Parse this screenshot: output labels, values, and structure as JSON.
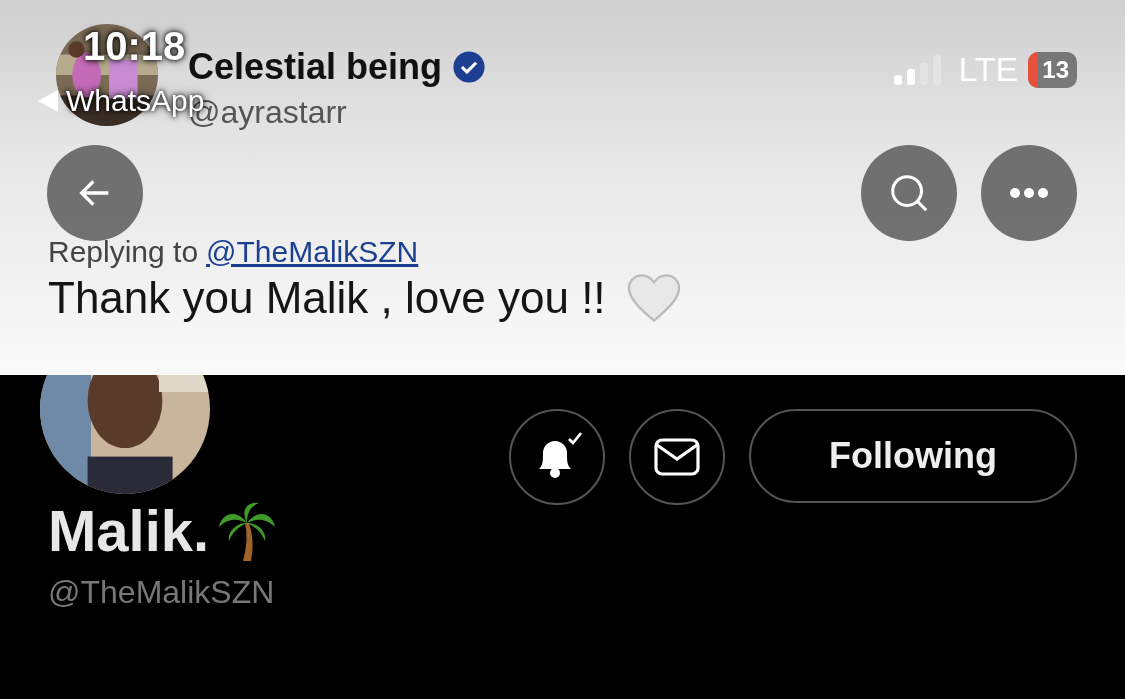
{
  "status_bar": {
    "time": "10:18",
    "back_app": "WhatsApp",
    "network": "LTE",
    "battery": "13"
  },
  "banner": {
    "kind": "tweet",
    "author": {
      "name": "Celestial being",
      "verified": true,
      "handle": "@ayrastarr"
    },
    "reply_prefix": "Replying to",
    "reply_to": "@TheMalikSZN",
    "text": "Thank you Malik , love you !!"
  },
  "profile": {
    "name": "Malik.",
    "handle": "@TheMalikSZN",
    "notifications_on": true,
    "follow_button": "Following"
  }
}
